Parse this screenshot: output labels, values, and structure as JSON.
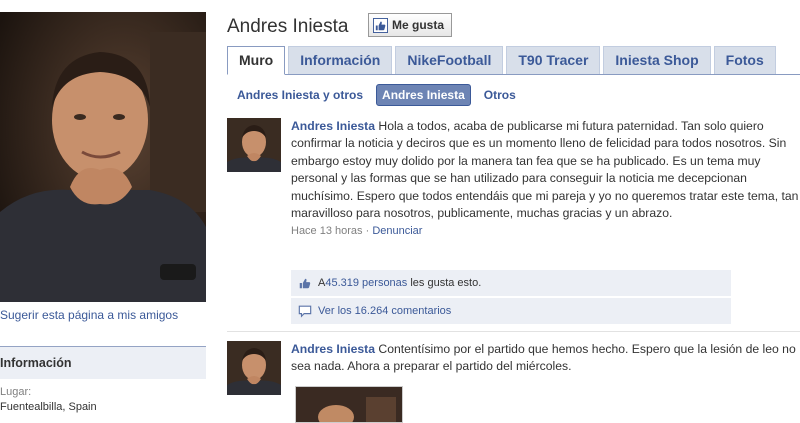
{
  "profile": {
    "name": "Andres Iniesta",
    "like_button": "Me gusta",
    "suggest_link": "Sugerir esta página a mis amigos",
    "info": {
      "title": "Información",
      "location_label": "Lugar:",
      "location_value": "Fuentealbilla, Spain"
    }
  },
  "tabs": [
    {
      "label": "Muro",
      "active": true
    },
    {
      "label": "Información",
      "active": false
    },
    {
      "label": "NikeFootball",
      "active": false
    },
    {
      "label": "T90 Tracer",
      "active": false
    },
    {
      "label": "Iniesta Shop",
      "active": false
    },
    {
      "label": "Fotos",
      "active": false
    }
  ],
  "filters": [
    {
      "label": "Andres Iniesta y otros",
      "selected": false
    },
    {
      "label": "Andres Iniesta",
      "selected": true
    },
    {
      "label": "Otros",
      "selected": false
    }
  ],
  "posts": [
    {
      "author": "Andres Iniesta",
      "text": "Hola a todos, acaba de publicarse mi futura paternidad. Tan solo quiero confirmar la noticia y deciros que es un momento lleno de felicidad para todos nosotros. Sin embargo estoy muy dolido por la manera tan fea que se ha publicado. Es un tema muy personal y las formas que se han utilizado para conseguir la noticia me decepcionan muchísimo. Espero que todos entendáis que mi pareja y yo no queremos tratar este tema, tan maravilloso para nosotros, publicamente, muchas gracias y un abrazo.",
      "time": "Hace 13 horas",
      "separator": " · ",
      "report": "Denunciar",
      "likes_prefix": "A ",
      "likes_link": "45.319 personas",
      "likes_suffix": " les gusta esto.",
      "comments": "Ver los 16.264 comentarios"
    },
    {
      "author": "Andres Iniesta",
      "text": "Contentísimo por el partido que hemos hecho. Espero que la lesión de leo no sea nada. Ahora a preparar el partido del miércoles."
    }
  ],
  "colors": {
    "link": "#3b5998",
    "tab_bg": "#d8dfea",
    "selected_filter": "#6d84b4",
    "ufi_bg": "#eceff5"
  },
  "icons": [
    "like-thumb-icon",
    "comment-bubble-icon"
  ]
}
